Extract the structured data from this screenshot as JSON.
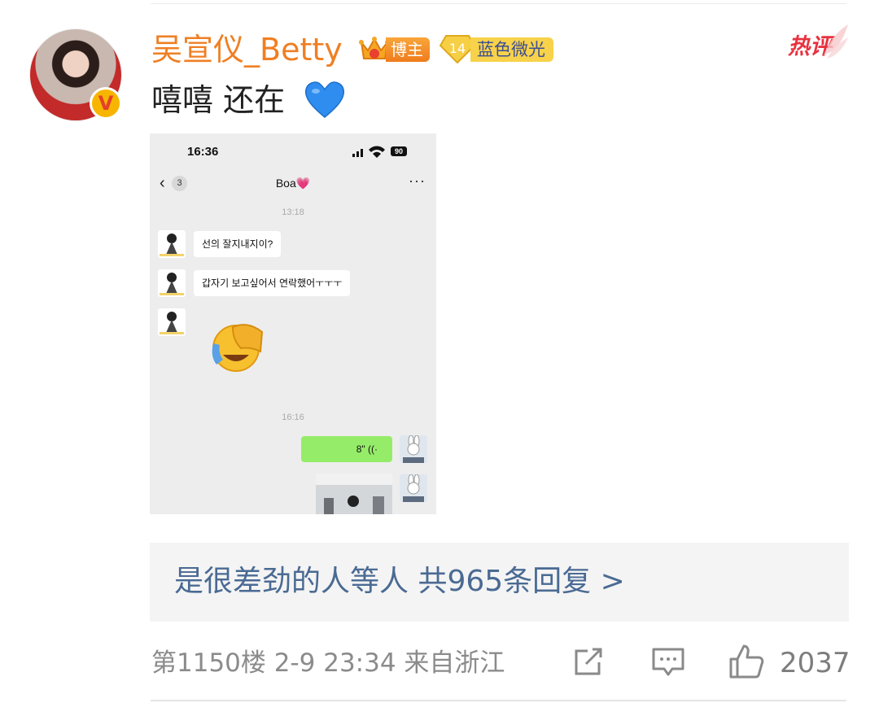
{
  "user": {
    "name": "吴宣仪_Betty",
    "host_badge": "博主",
    "level_number": "14",
    "level_name": "蓝色微光",
    "verified_mark": "V",
    "hot_label": "热评"
  },
  "comment": {
    "text": "嘻嘻 还在",
    "emoji": "blue-heart"
  },
  "screenshot": {
    "status_time": "16:36",
    "battery": "90",
    "back_count": "3",
    "chat_title": "Boa💗",
    "more": "···",
    "timestamps": [
      "13:18",
      "16:16"
    ],
    "messages": [
      {
        "from": "other",
        "text": "선의 잘지내지이?"
      },
      {
        "from": "other",
        "text": "갑자기 보고싶어서 연락했어ㅜㅜㅜ"
      },
      {
        "from": "other",
        "text": "",
        "emoji": "facepalm-laugh"
      },
      {
        "from": "self",
        "text": "8\" ((·",
        "type": "voice"
      },
      {
        "from": "self",
        "text": "",
        "type": "photo"
      }
    ]
  },
  "replies": {
    "text": "是很差劲的人等人  共965条回复 >"
  },
  "footer": {
    "meta": "第1150楼  2-9 23:34  来自浙江",
    "likes": "2037"
  },
  "colors": {
    "username": "#ef7f23",
    "reply_link": "#4a6a93",
    "hot": "#e8323f",
    "voice_bubble": "#95ec69"
  }
}
